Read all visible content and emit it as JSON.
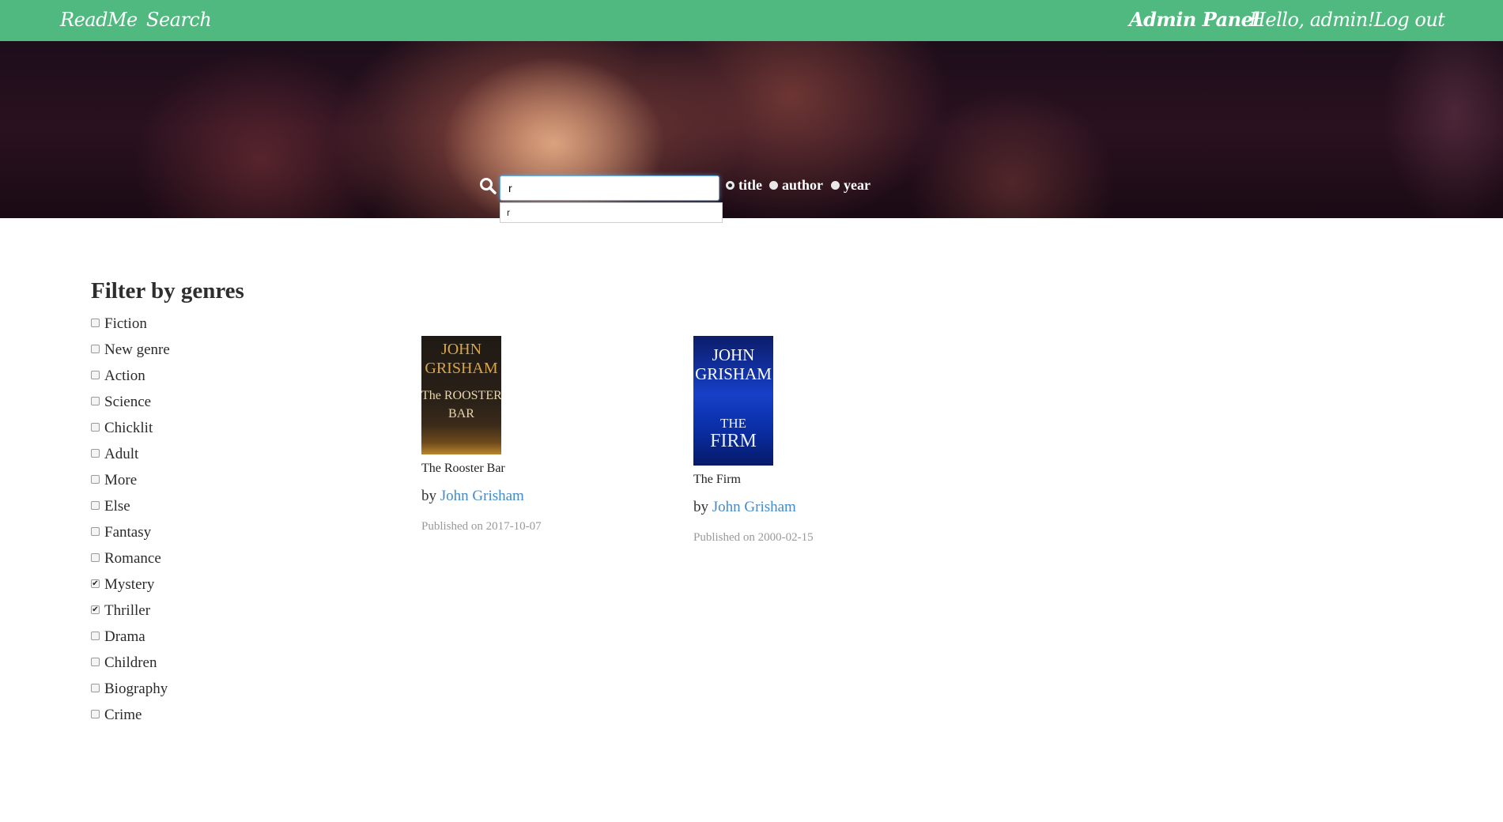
{
  "nav": {
    "brand": "ReadMe",
    "search": "Search",
    "admin_panel": "Admin Panel",
    "greeting": "Hello, admin!",
    "logout": "Log out"
  },
  "search": {
    "value": "r",
    "suggestion": "r",
    "options": [
      {
        "label": "title",
        "checked": true
      },
      {
        "label": "author",
        "checked": false
      },
      {
        "label": "year",
        "checked": false
      }
    ]
  },
  "filters": {
    "title": "Filter by genres",
    "genres": [
      {
        "label": "Fiction",
        "checked": false
      },
      {
        "label": "New genre",
        "checked": false
      },
      {
        "label": "Action",
        "checked": false
      },
      {
        "label": "Science",
        "checked": false
      },
      {
        "label": "Chicklit",
        "checked": false
      },
      {
        "label": "Adult",
        "checked": false
      },
      {
        "label": "More",
        "checked": false
      },
      {
        "label": "Else",
        "checked": false
      },
      {
        "label": "Fantasy",
        "checked": false
      },
      {
        "label": "Romance",
        "checked": false
      },
      {
        "label": "Mystery",
        "checked": true
      },
      {
        "label": "Thriller",
        "checked": true
      },
      {
        "label": "Drama",
        "checked": false
      },
      {
        "label": "Children",
        "checked": false
      },
      {
        "label": "Biography",
        "checked": false
      },
      {
        "label": "Crime",
        "checked": false
      }
    ]
  },
  "books": [
    {
      "title": "The Rooster Bar",
      "by": "by",
      "author": "John Grisham",
      "published": "Published on 2017-10-07",
      "cover": {
        "author_line1": "JOHN",
        "author_line2": "GRISHAM",
        "title_line1": "The ROOSTER",
        "title_line2": "BAR",
        "color": "#2b241c"
      }
    },
    {
      "title": "The Firm",
      "by": "by",
      "author": "John Grisham",
      "published": "Published on 2000-02-15",
      "cover": {
        "author_line1": "JOHN",
        "author_line2": "GRISHAM",
        "title_line1": "THE",
        "title_line2": "FIRM",
        "color": "#0a2d8f"
      }
    }
  ],
  "colors": {
    "navbar": "#4fb97f",
    "link": "#428bca",
    "date": "#999999"
  }
}
